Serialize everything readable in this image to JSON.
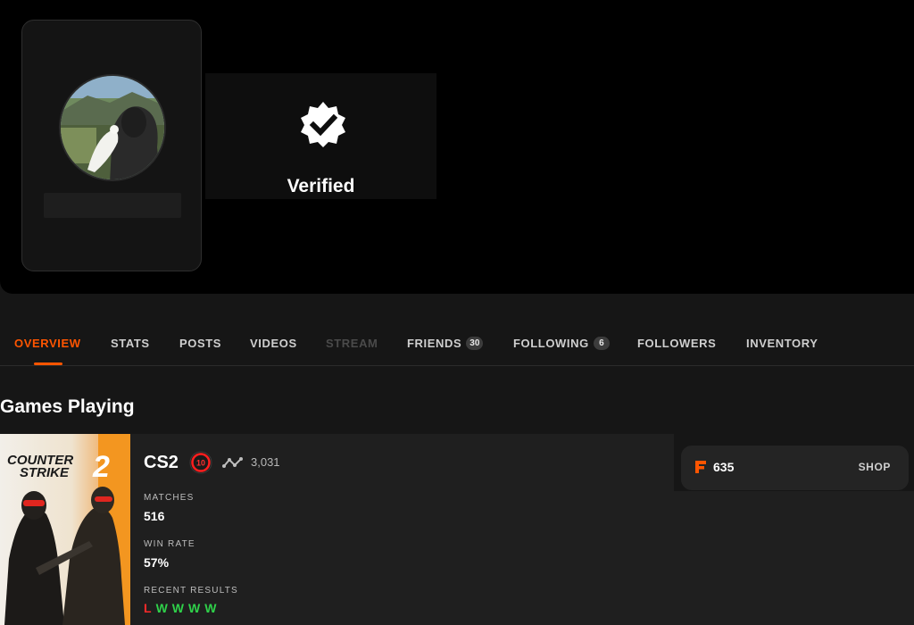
{
  "profile": {
    "verified_label": "Verified"
  },
  "tabs": [
    {
      "label": "OVERVIEW",
      "state": "active"
    },
    {
      "label": "STATS",
      "state": "normal"
    },
    {
      "label": "POSTS",
      "state": "normal"
    },
    {
      "label": "VIDEOS",
      "state": "normal"
    },
    {
      "label": "STREAM",
      "state": "disabled"
    },
    {
      "label": "FRIENDS",
      "badge": "30",
      "state": "normal"
    },
    {
      "label": "FOLLOWING",
      "badge": "6",
      "state": "normal"
    },
    {
      "label": "FOLLOWERS",
      "state": "normal"
    },
    {
      "label": "INVENTORY",
      "state": "normal"
    }
  ],
  "games_section": {
    "title": "Games Playing"
  },
  "game": {
    "cover_title_line1": "COUNTER",
    "cover_title_line2": "STRIKE",
    "cover_number": "2",
    "name": "CS2",
    "skill_level": "10",
    "elo": "3,031",
    "matches_label": "MATCHES",
    "matches_value": "516",
    "win_rate_label": "WIN RATE",
    "win_rate_value": "57%",
    "recent_results_label": "RECENT RESULTS",
    "recent_results": [
      "L",
      "W",
      "W",
      "W",
      "W"
    ]
  },
  "shop": {
    "points": "635",
    "button_label": "SHOP"
  },
  "colors": {
    "accent": "#ff5500",
    "win": "#2fd14a",
    "loss": "#ff2a2a"
  }
}
